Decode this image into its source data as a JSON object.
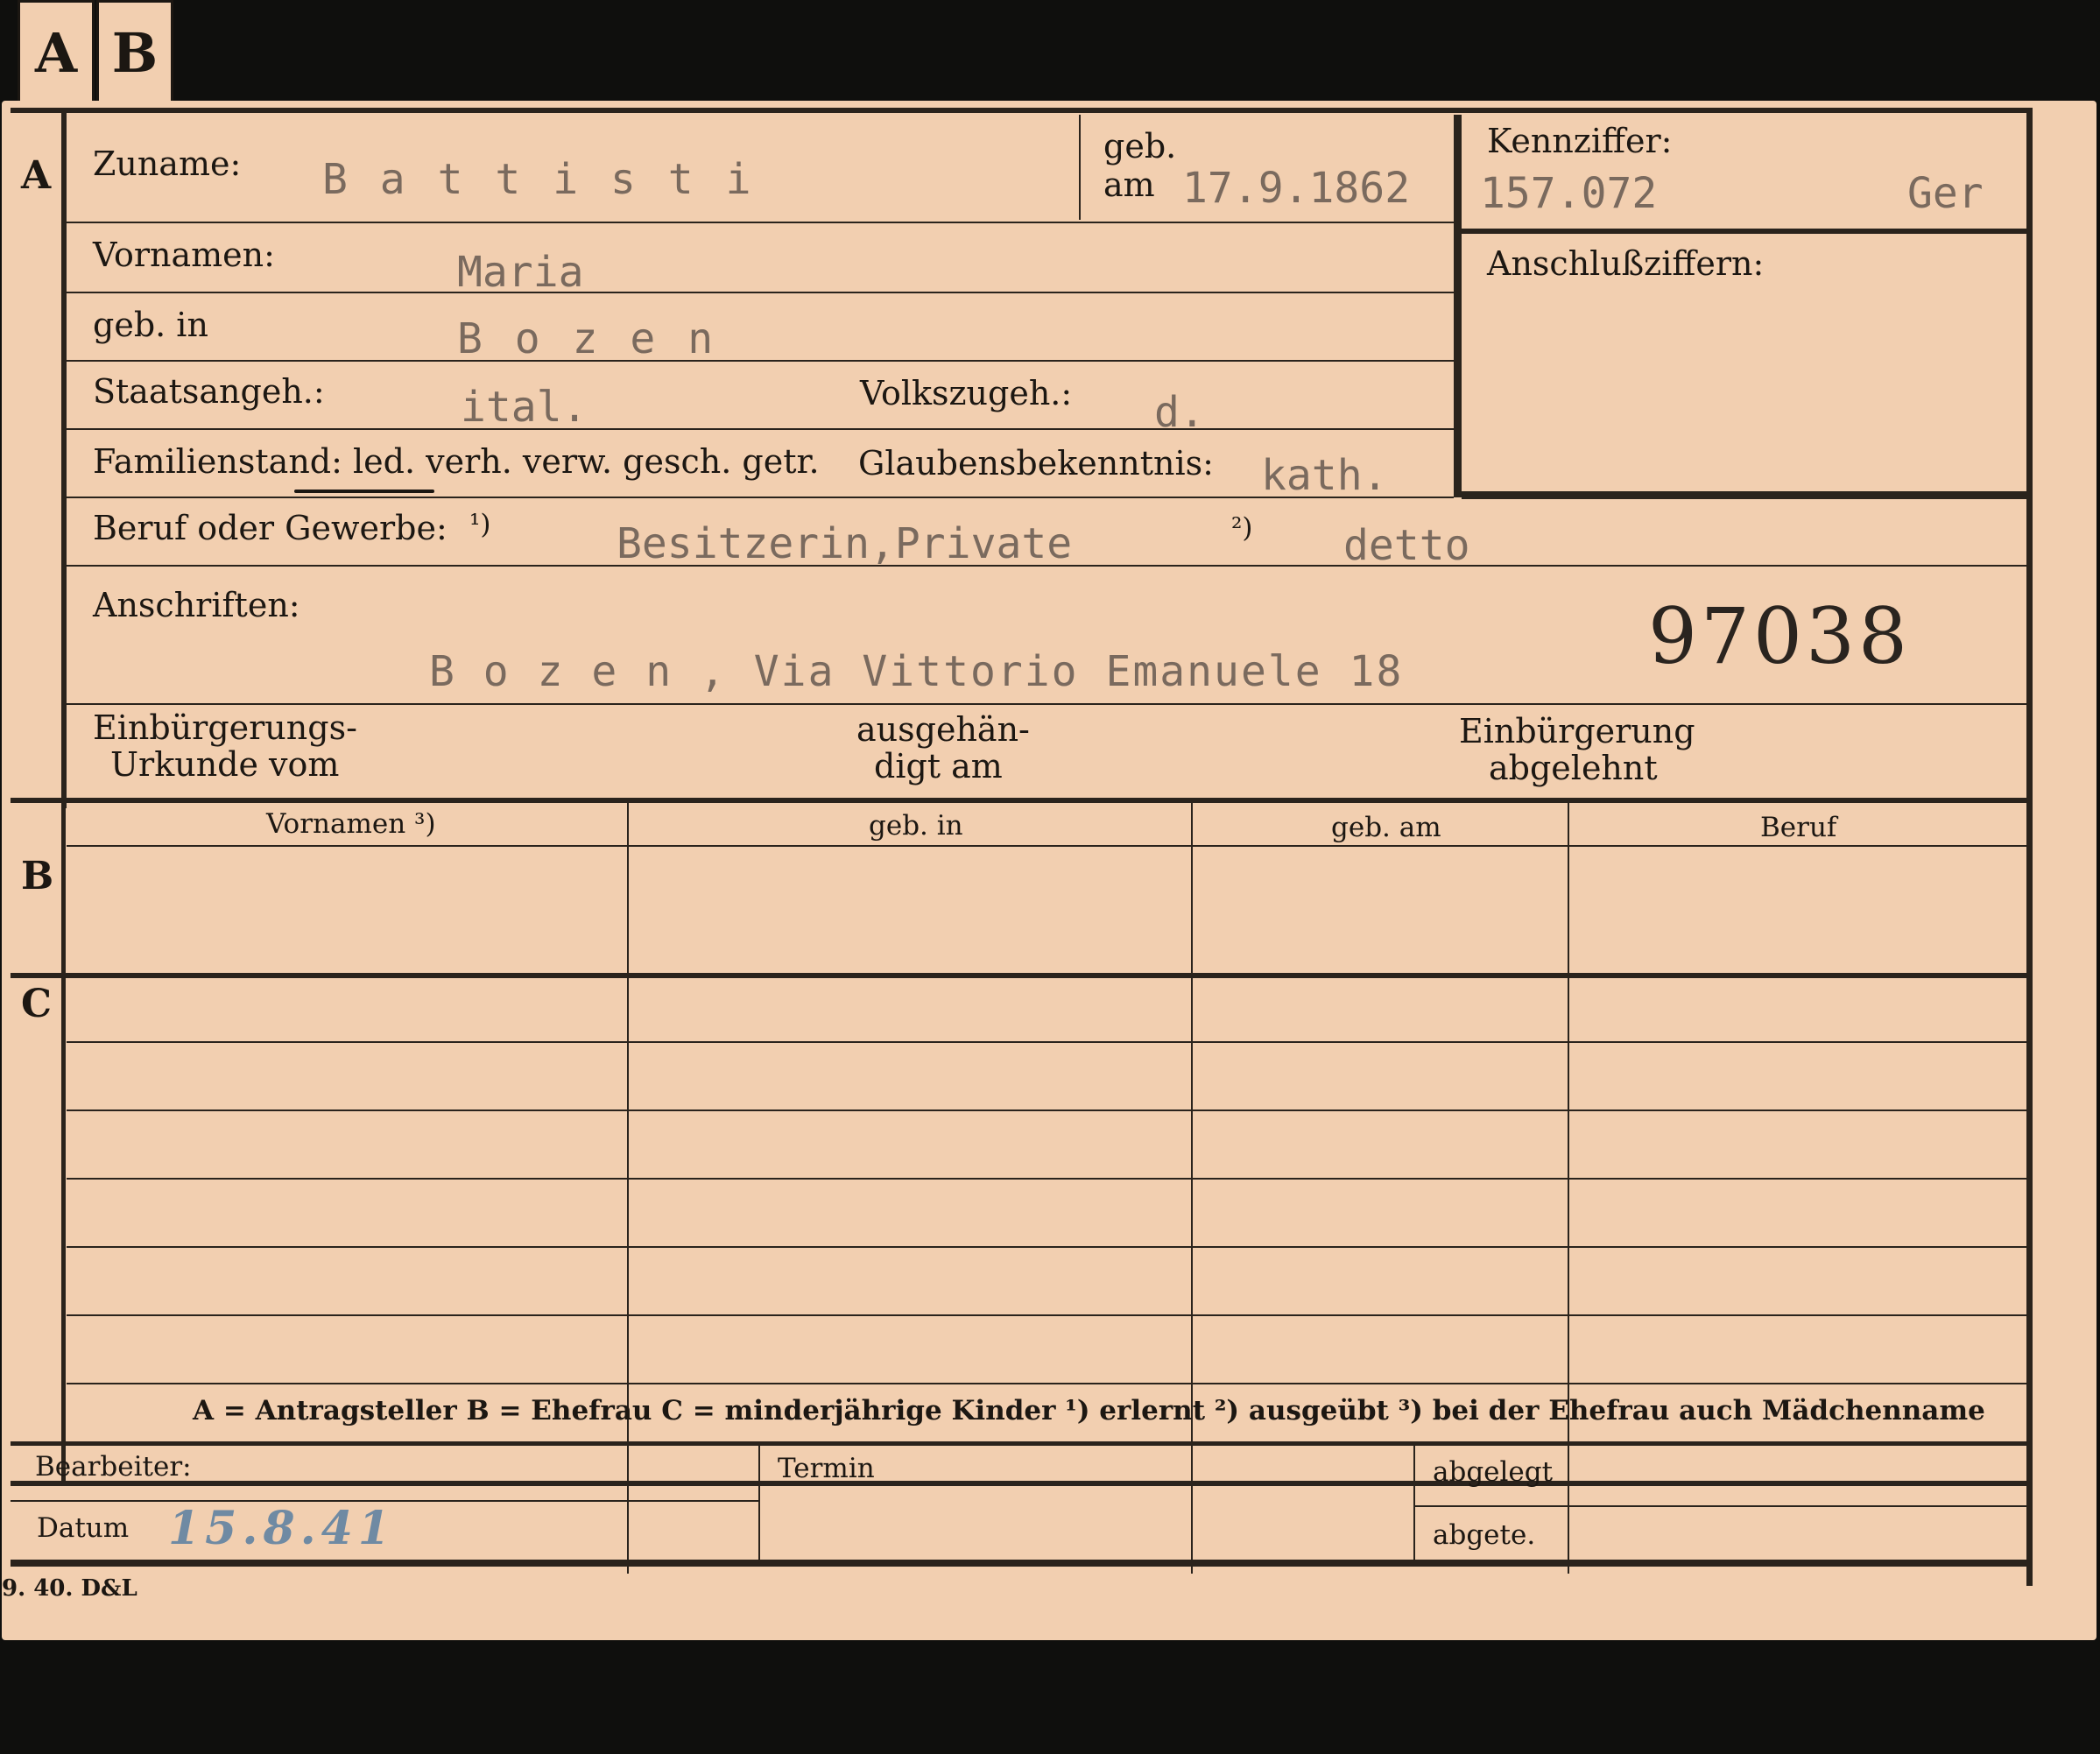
{
  "tabs": {
    "a": "A",
    "b": "B"
  },
  "sections": {
    "a": "A",
    "b": "B",
    "c": "C"
  },
  "labels": {
    "zuname": "Zuname:",
    "geb": "geb.",
    "am": "am",
    "kennziffer": "Kennziffer:",
    "vornamen": "Vornamen:",
    "geb_in": "geb. in",
    "anschlussziffern": "Anschlußziffern:",
    "staatsangeh": "Staatsangeh.:",
    "volkszugeh": "Volkszugeh.:",
    "familienstand": "Familienstand: led. verh. verw. gesch. getr.",
    "glaubensbekenntnis": "Glaubensbekenntnis:",
    "beruf_oder_gewerbe": "Beruf oder Gewerbe:",
    "note1": "¹)",
    "note2": "²)",
    "anschriften": "Anschriften:",
    "einbuergerung_urkunde_1": "Einbürgerungs-",
    "einbuergerung_urkunde_2": "Urkunde vom",
    "ausgehaendigt_1": "ausgehän-",
    "ausgehaendigt_2": "digt am",
    "einbuergerung_abgelehnt_1": "Einbürgerung",
    "einbuergerung_abgelehnt_2": "abgelehnt",
    "col_vornamen": "Vornamen ³)",
    "col_geb_in": "geb. in",
    "col_geb_am": "geb. am",
    "col_beruf": "Beruf",
    "legend": "A = Antragsteller    B = Ehefrau    C = minderjährige Kinder    ¹) erlernt    ²) ausgeübt    ³) bei der Ehefrau auch Mädchenname",
    "bearbeiter": "Bearbeiter:",
    "termin": "Termin",
    "abgelegt": "abgelegt",
    "datum": "Datum",
    "abgete": "abgete.",
    "print_code": "9. 40. D&L"
  },
  "values": {
    "zuname": "B a t t i s t i",
    "geb_am": "17.9.1862",
    "kennziffer": "157.072",
    "kennziffer_suffix": "Ger",
    "vornamen": "Maria",
    "geb_in": "B o z e n",
    "staatsangeh": "ital.",
    "volkszugeh": "d.",
    "glaubensbekenntnis": "kath.",
    "beruf_erlernt": "Besitzerin,Private",
    "beruf_ausgeuebt": "detto",
    "anschrift": "B o z e n , Via Vittorio Emanuele 18",
    "stamp_number": "97038",
    "datum": "15.8.41"
  },
  "colors": {
    "card": "#f2cfb0",
    "ink": "#1c1712",
    "typewriter": "#7a6a5e",
    "handwriting": "#6f8aa3",
    "background": "#0f0f0d"
  }
}
